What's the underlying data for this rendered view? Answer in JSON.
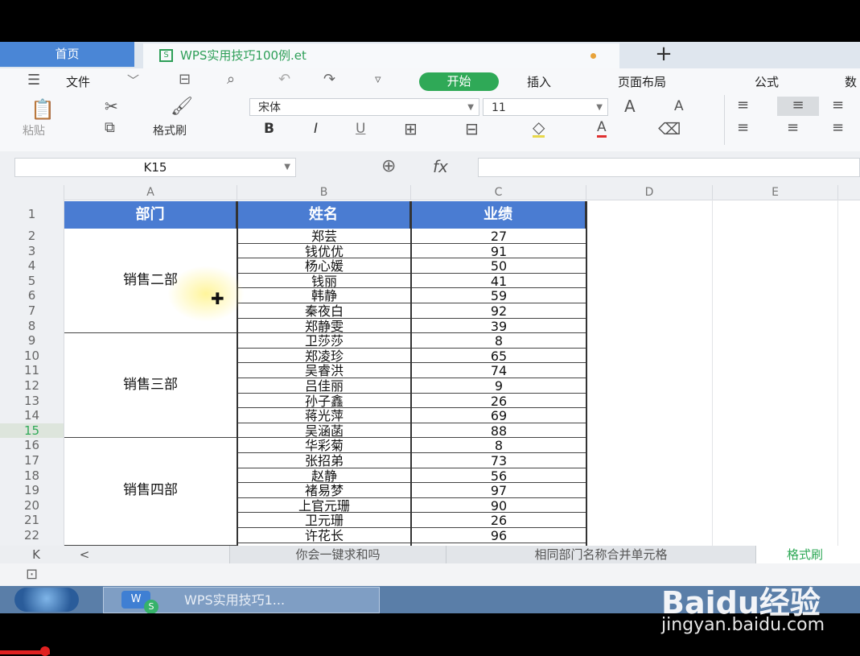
{
  "tabs": {
    "home": "首页",
    "file_icon": "S",
    "file": "WPS实用技巧100例.et",
    "new": "+"
  },
  "menu": {
    "file": "文件",
    "items": [
      "开始",
      "插入",
      "页面布局",
      "公式",
      "数"
    ]
  },
  "ribbon": {
    "paste": "粘贴",
    "format_painter": "格式刷",
    "font_name": "宋体",
    "font_size": "11",
    "bold": "B",
    "italic": "I",
    "underline": "U",
    "grow": "A",
    "shrink": "A",
    "font_color": "A"
  },
  "formula": {
    "cell_ref": "K15",
    "fx": "fx",
    "value": ""
  },
  "columns": [
    "A",
    "B",
    "C",
    "D",
    "E"
  ],
  "rows": [
    "1",
    "2",
    "3",
    "4",
    "5",
    "6",
    "7",
    "8",
    "9",
    "10",
    "11",
    "12",
    "13",
    "14",
    "15",
    "16",
    "17",
    "18",
    "19",
    "20",
    "21",
    "22"
  ],
  "headers": [
    "部门",
    "姓名",
    "业绩"
  ],
  "departments": [
    "销售二部",
    "销售三部",
    "销售四部"
  ],
  "names": [
    "郑芸",
    "钱优优",
    "杨心媛",
    "钱丽",
    "韩静",
    "秦夜白",
    "郑静雯",
    "卫莎莎",
    "郑凌珍",
    "吴睿洪",
    "吕佳丽",
    "孙子鑫",
    "蒋光萍",
    "吴涵菡",
    "华彩菊",
    "张招弟",
    "赵静",
    "褚易梦",
    "上官元珊",
    "卫元珊",
    "许花长"
  ],
  "scores": [
    "27",
    "91",
    "50",
    "41",
    "59",
    "92",
    "39",
    "8",
    "65",
    "74",
    "9",
    "26",
    "69",
    "88",
    "8",
    "73",
    "56",
    "97",
    "90",
    "26",
    "96"
  ],
  "sheet_tabs": [
    "你会一键求和吗",
    "相同部门名称合并单元格",
    "格式刷"
  ],
  "sheet_nav": [
    "K",
    "<"
  ],
  "taskbar": {
    "icon": "W",
    "badge": "S",
    "item": "WPS实用技巧1..."
  },
  "watermark": {
    "logo": "Baidu经验",
    "url": "jingyan.baidu.com"
  },
  "colors": {
    "accent": "#2fa957",
    "header_blue": "#4a7cd2",
    "home_tab": "#4a86d6"
  }
}
